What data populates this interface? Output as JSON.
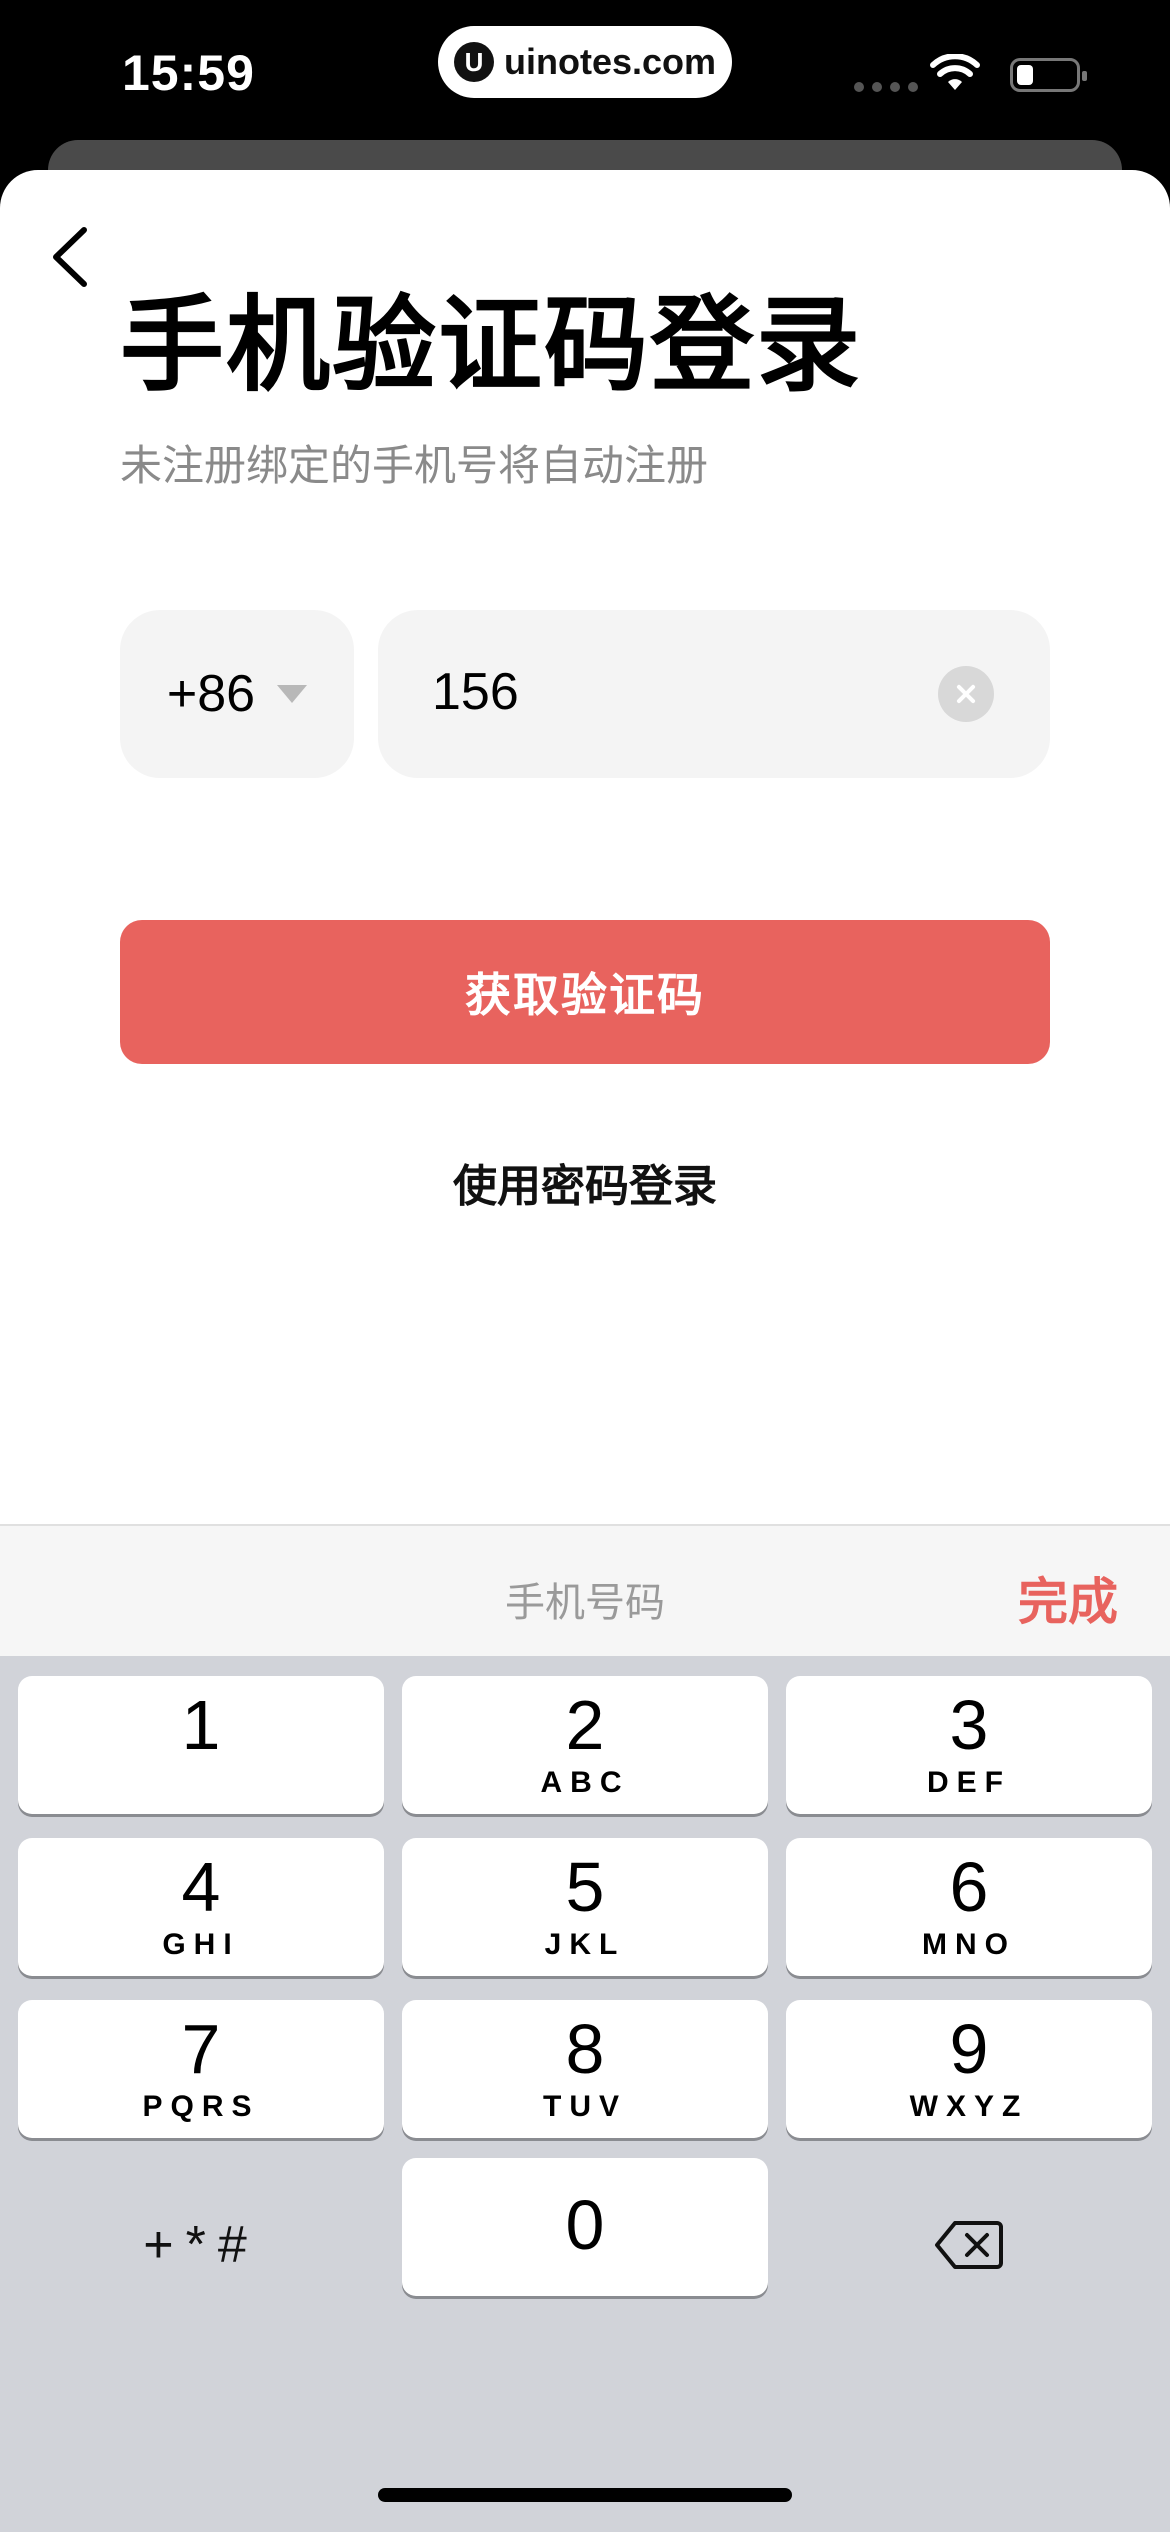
{
  "status_bar": {
    "time": "15:59",
    "pill_text": "uinotes.com",
    "pill_logo": "U"
  },
  "screen": {
    "title": "手机验证码登录",
    "subtitle": "未注册绑定的手机号将自动注册",
    "country_code": "+86",
    "phone_value": "156",
    "get_code_label": "获取验证码",
    "password_login_label": "使用密码登录"
  },
  "keyboard": {
    "accessory_label": "手机号码",
    "done_label": "完成",
    "keys": [
      {
        "num": "1",
        "letters": ""
      },
      {
        "num": "2",
        "letters": "ABC"
      },
      {
        "num": "3",
        "letters": "DEF"
      },
      {
        "num": "4",
        "letters": "GHI"
      },
      {
        "num": "5",
        "letters": "JKL"
      },
      {
        "num": "6",
        "letters": "MNO"
      },
      {
        "num": "7",
        "letters": "PQRS"
      },
      {
        "num": "8",
        "letters": "TUV"
      },
      {
        "num": "9",
        "letters": "WXYZ"
      },
      {
        "num": "0",
        "letters": ""
      }
    ],
    "symbols_label": "+*#"
  },
  "icons": [
    "back-chevron-icon",
    "dropdown-caret-icon",
    "clear-icon",
    "backspace-icon",
    "wifi-icon",
    "battery-icon"
  ],
  "colors": {
    "accent": "#e8635e",
    "input_bg": "#f4f4f4",
    "keyboard_bg": "#d1d3d9"
  }
}
